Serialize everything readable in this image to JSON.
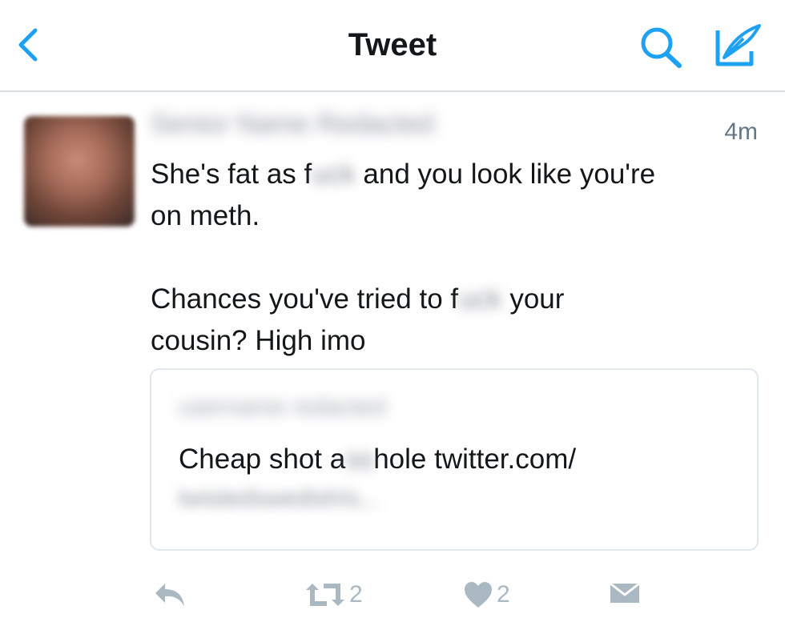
{
  "nav": {
    "title": "Tweet",
    "back_icon": "chevron-left-icon",
    "search_icon": "search-icon",
    "compose_icon": "compose-icon",
    "accent_color": "#1da1f2"
  },
  "tweet": {
    "author_name": "Senior Name Redacted",
    "time": "4m",
    "text_part1": "She's fat as f",
    "text_redacted1": "uck",
    "text_part2": " and you look like you're\non meth.\n\nChances you've tried to f",
    "text_redacted2": "uck",
    "text_part3": " your\ncousin? High imo"
  },
  "quote": {
    "author_name": "username redacted",
    "text_part1": "Cheap shot a",
    "text_redacted": "ss",
    "text_part2": "hole twitter.com/",
    "link_redacted": "twistedswedish/s..."
  },
  "actions": {
    "reply_icon": "reply-icon",
    "retweet_icon": "retweet-icon",
    "retweet_count": "2",
    "like_icon": "heart-icon",
    "like_count": "2",
    "dm_icon": "envelope-icon",
    "icon_color": "#aab8c2"
  }
}
